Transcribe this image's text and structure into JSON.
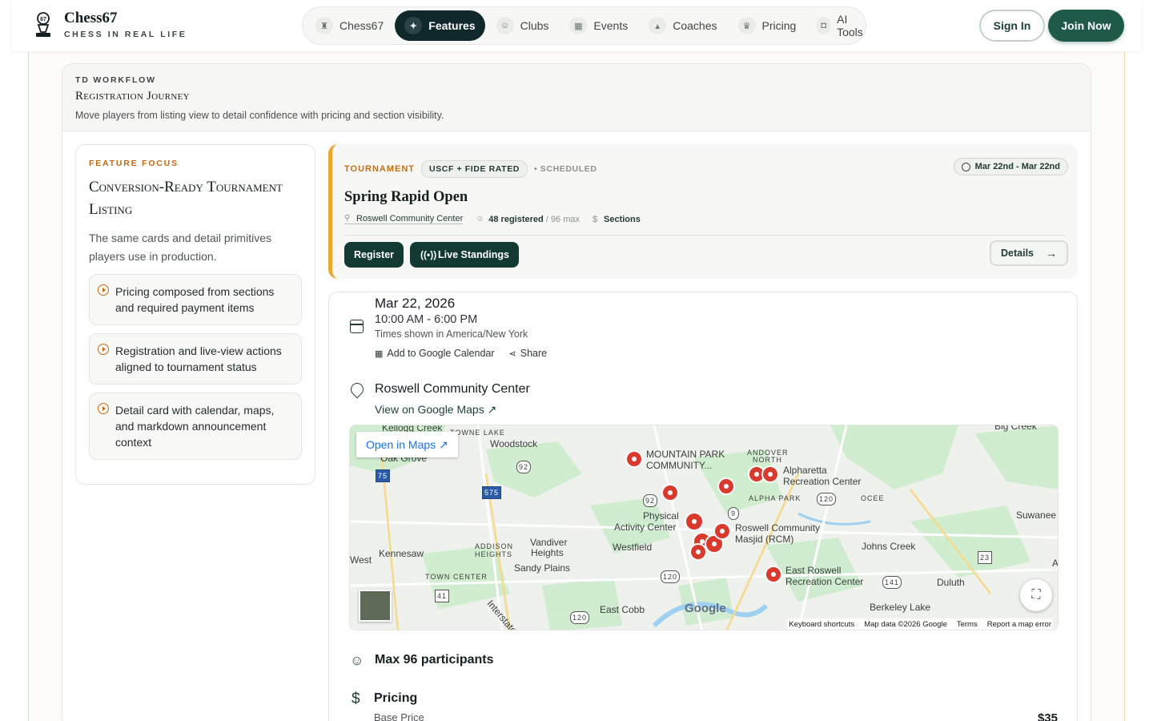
{
  "brand": {
    "name": "Chess67",
    "tagline": "CHESS IN REAL LIFE",
    "logo_icon": "chess-pawn-icon"
  },
  "nav": {
    "items": [
      {
        "label": "Chess67",
        "icon": "rook-icon",
        "active": false
      },
      {
        "label": "Features",
        "icon": "sparkle-icon",
        "active": true
      },
      {
        "label": "Clubs",
        "icon": "users-icon",
        "active": false
      },
      {
        "label": "Events",
        "icon": "calendar-icon",
        "active": false
      },
      {
        "label": "Coaches",
        "icon": "graduation-cap-icon",
        "active": false
      },
      {
        "label": "Pricing",
        "icon": "crown-icon",
        "active": false
      },
      {
        "label": "AI Tools",
        "icon": "robot-icon",
        "active": false
      }
    ],
    "sign_in": "Sign In",
    "join": "Join Now"
  },
  "panel": {
    "eyebrow": "TD WORKFLOW",
    "title": "Registration Journey",
    "subtitle": "Move players from listing view to detail confidence with pricing and section visibility."
  },
  "focus": {
    "eyebrow": "FEATURE FOCUS",
    "title": "Conversion-Ready Tournament Listing",
    "description": "The same cards and detail primitives players use in production.",
    "bullets": [
      "Pricing composed from sections and required payment items",
      "Registration and live-view actions aligned to tournament status",
      "Detail card with calendar, maps, and markdown announcement context"
    ]
  },
  "tournament": {
    "type": "TOURNAMENT",
    "rating": "USCF + FIDE RATED",
    "status": "• SCHEDULED",
    "date_range": "Mar 22nd - Mar 22nd",
    "title": "Spring Rapid Open",
    "venue": "Roswell Community Center",
    "registered": "48 registered",
    "max": " / 96 max",
    "sections": "Sections",
    "register": "Register",
    "live": "Live Standings",
    "details": "Details"
  },
  "detail": {
    "date": "Mar 22, 2026",
    "time": "10:00 AM - 6:00 PM",
    "timezone": "Times shown in America/New York",
    "add_calendar": "Add to Google Calendar",
    "share": "Share",
    "venue": "Roswell Community Center",
    "view_maps": "View on Google Maps",
    "map": {
      "open": "Open in Maps",
      "google": "Google",
      "footer": [
        "Keyboard shortcuts",
        "Map data ©2026 Google",
        "Terms",
        "Report a map error"
      ],
      "labels": {
        "kellogg": "Kellogg Creek",
        "townelake": "TOWNE LAKE",
        "woodstock": "Woodstock",
        "oakgrove": "Oak Grove",
        "mtnpark1": "MOUNTAIN PARK",
        "mtnpark2": "COMMUNITY...",
        "andover1": "ANDOVER",
        "andover2": "NORTH",
        "alpharetta1": "Alpharetta",
        "alpharetta2": "Recreation Center",
        "alphapark": "ALPHA PARK",
        "ocee": "OCEE",
        "suwanee": "Suwanee",
        "physical1": "Physical",
        "physical2": "Activity Center",
        "roswell1": "Roswell Community",
        "roswell2": "Masjid (RCM)",
        "addison1": "ADDISON",
        "addison2": "HEIGHTS",
        "vandiver1": "Vandiver",
        "vandiver2": "Heights",
        "westfield": "Westfield",
        "johnscreek": "Johns Creek",
        "west": "West",
        "kennesaw": "Kennesaw",
        "sandyplains": "Sandy Plains",
        "eastroswell1": "East Roswell",
        "eastroswell2": "Recreation Center",
        "towncenter": "TOWN CENTER",
        "duluth": "Duluth",
        "berkeley": "Berkeley Lake",
        "eastcobb": "East Cobb",
        "interstate": "Interstate",
        "a": "A",
        "bigcreek": "Big Creek",
        "r92a": "92",
        "r92b": "92",
        "r9": "9",
        "r120a": "120",
        "r120b": "120",
        "r120c": "120",
        "r141": "141",
        "r23": "23",
        "r41": "41",
        "r75": "75",
        "r575": "575"
      }
    },
    "max_participants": "Max 96 participants",
    "pricing": "Pricing",
    "base_price": "Base Price",
    "price": "$35"
  }
}
